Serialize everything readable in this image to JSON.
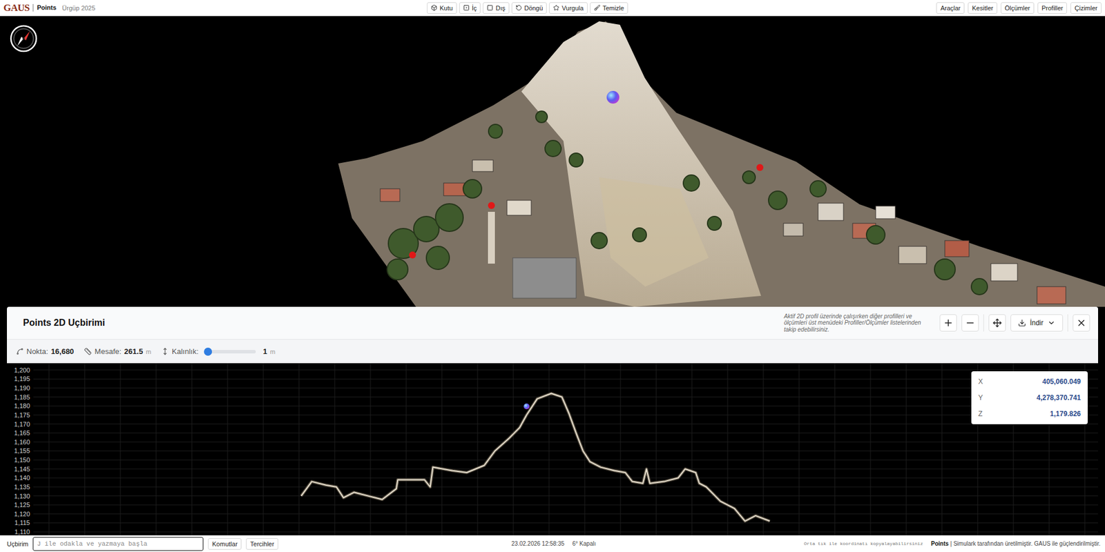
{
  "app": {
    "logo": "GAUS",
    "product": "Points",
    "project": "Ürgüp 2025"
  },
  "tools": [
    {
      "label": "Kutu"
    },
    {
      "label": "İç"
    },
    {
      "label": "Dış"
    },
    {
      "label": "Döngü"
    },
    {
      "label": "Vurgula"
    },
    {
      "label": "Temizle"
    }
  ],
  "menu": [
    "Araçlar",
    "Kesitler",
    "Ölçümler",
    "Profiller",
    "Çizimler"
  ],
  "panel": {
    "title": "Points 2D Uçbirimi",
    "hint": "Aktif 2D profil üzerinde çalışırken diğer profilleri ve ölçümleri üst menüdeki Profiller/Ölçümler listelerinden takip edebilirsiniz.",
    "download": "İndir",
    "stats": [
      {
        "label": "Nokta:",
        "value": "16,680",
        "unit": ""
      },
      {
        "label": "Mesafe:",
        "value": "261.5",
        "unit": "m"
      }
    ],
    "thickness": {
      "label": "Kalınlık:",
      "level": 0.0,
      "reading": "1",
      "unit": "m"
    }
  },
  "chart": {
    "y_ticks": [
      "1,200",
      "1,195",
      "1,190",
      "1,185",
      "1,180",
      "1,175",
      "1,170",
      "1,165",
      "1,160",
      "1,155",
      "1,150",
      "1,145",
      "1,140",
      "1,135",
      "1,130",
      "1,125",
      "1,120",
      "1,115",
      "1,110"
    ],
    "profile": {
      "distance": 261.5,
      "points": [
        [
          0,
          1130
        ],
        [
          5.9,
          1138
        ],
        [
          13.8,
          1136
        ],
        [
          19.7,
          1135
        ],
        [
          23.6,
          1129
        ],
        [
          29.5,
          1132
        ],
        [
          37.4,
          1130
        ],
        [
          45.2,
          1128
        ],
        [
          53.1,
          1134
        ],
        [
          53.9,
          1139
        ],
        [
          61.0,
          1139
        ],
        [
          68.8,
          1139
        ],
        [
          72.0,
          1135
        ],
        [
          73.5,
          1146
        ],
        [
          84.5,
          1144
        ],
        [
          92.4,
          1143
        ],
        [
          102.2,
          1147
        ],
        [
          108.1,
          1155
        ],
        [
          116.0,
          1162
        ],
        [
          121.9,
          1168
        ],
        [
          125.8,
          1175
        ],
        [
          131.7,
          1184
        ],
        [
          139.6,
          1187
        ],
        [
          145.5,
          1185
        ],
        [
          149.4,
          1176
        ],
        [
          153.4,
          1165
        ],
        [
          157.3,
          1155
        ],
        [
          161.2,
          1149
        ],
        [
          167.1,
          1146
        ],
        [
          175.0,
          1144
        ],
        [
          180.9,
          1143
        ],
        [
          184.8,
          1138
        ],
        [
          190.7,
          1137
        ],
        [
          192.7,
          1145
        ],
        [
          194.6,
          1137
        ],
        [
          202.5,
          1138
        ],
        [
          210.4,
          1140
        ],
        [
          214.3,
          1145
        ],
        [
          220.2,
          1143
        ],
        [
          222.2,
          1137
        ],
        [
          226.1,
          1135
        ],
        [
          234.0,
          1127
        ],
        [
          241.8,
          1123
        ],
        [
          247.7,
          1116
        ],
        [
          253.6,
          1119
        ],
        [
          261.5,
          1116
        ]
      ]
    },
    "cursor": {
      "distance": 125.8,
      "z": 1179.8
    },
    "coords": [
      {
        "axis": "X",
        "value": "405,060.049"
      },
      {
        "axis": "Y",
        "value": "4,278,370.741"
      },
      {
        "axis": "Z",
        "value": "1,179.826"
      }
    ]
  },
  "status_bar": {
    "label": "Uçbirim",
    "placeholder": "J ile odakla ve yazmaya başla",
    "buttons": [
      "Komutlar",
      "Tercihler"
    ],
    "datetime": "23.02.2026 12:58:35",
    "weather": "6° Kapalı",
    "hint": "Orta tık ile koordinatı kopyalayabilirsiniz",
    "brand": "Points",
    "credit": "| Simulark tarafından üretilmiştir. GAUS ile güçlendirilmiştir."
  }
}
